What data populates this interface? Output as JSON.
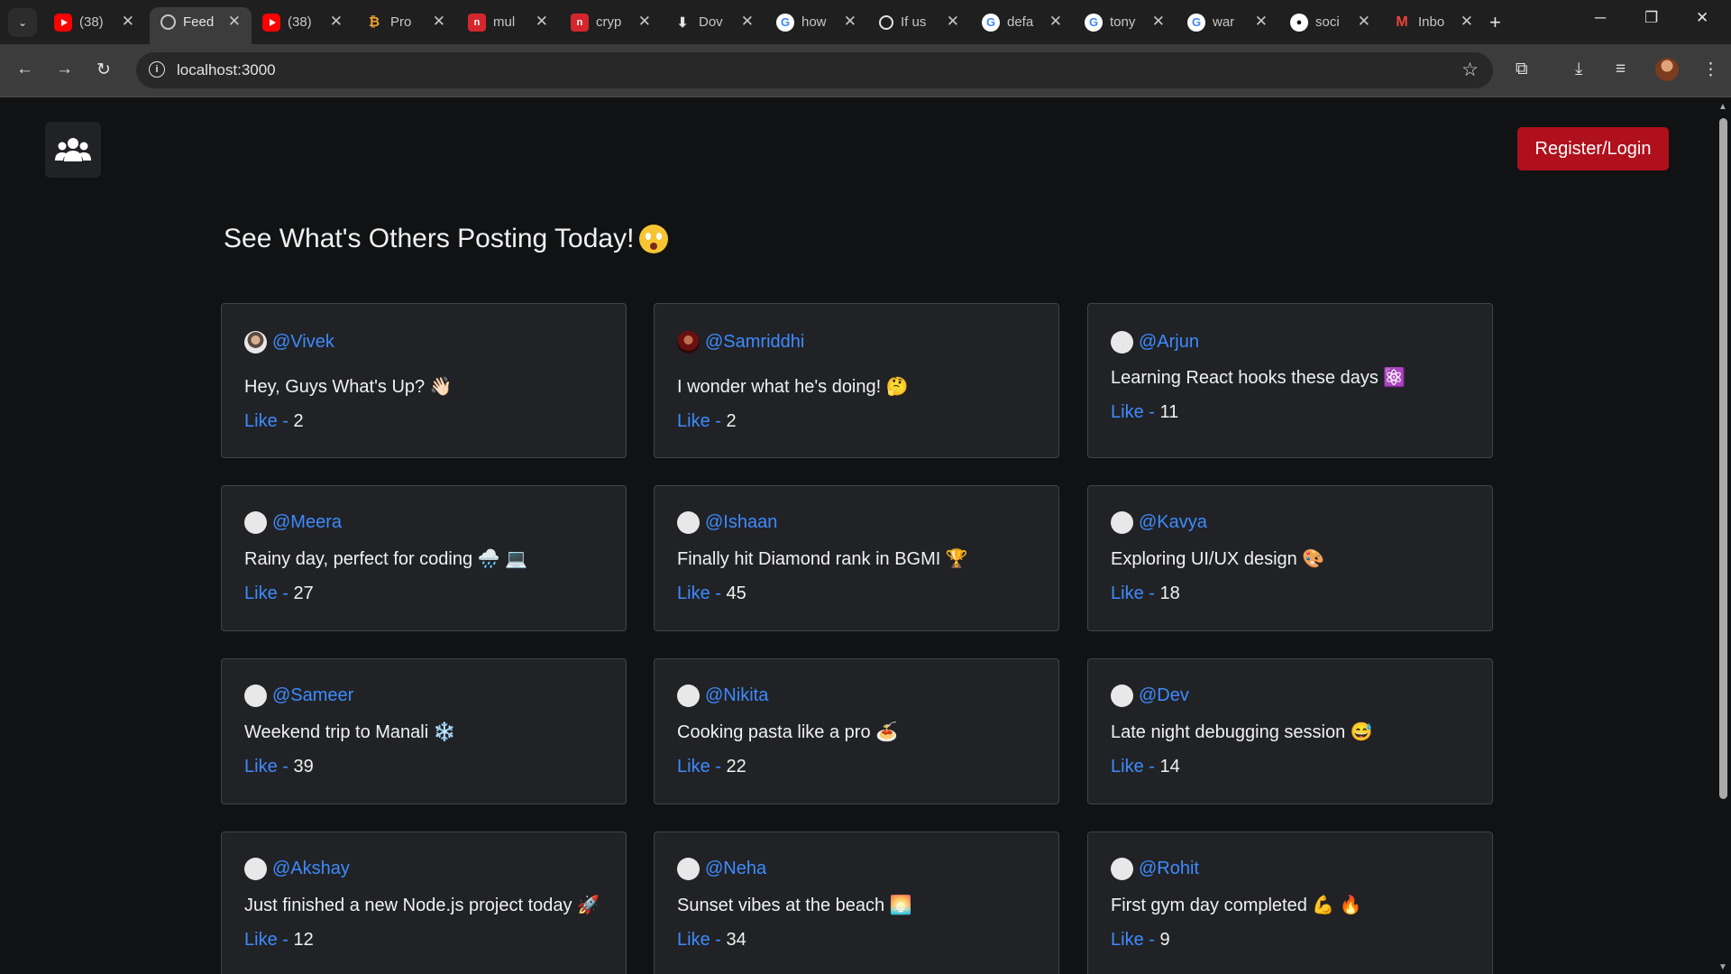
{
  "browser": {
    "tabs": [
      {
        "favicon": "youtube-icon",
        "title": "(38)"
      },
      {
        "favicon": "globe-icon",
        "title": "Feed",
        "active": true
      },
      {
        "favicon": "youtube-icon",
        "title": "(38)"
      },
      {
        "favicon": "bitcoin-icon",
        "title": "Pro"
      },
      {
        "favicon": "n-icon",
        "title": "mul"
      },
      {
        "favicon": "n-icon",
        "title": "cryp"
      },
      {
        "favicon": "download-icon",
        "title": "Dov"
      },
      {
        "favicon": "google-icon",
        "title": "how"
      },
      {
        "favicon": "openai-icon",
        "title": "If us"
      },
      {
        "favicon": "google-icon",
        "title": "defa"
      },
      {
        "favicon": "google-icon",
        "title": "tony"
      },
      {
        "favicon": "google-icon",
        "title": "war"
      },
      {
        "favicon": "github-icon",
        "title": "soci"
      },
      {
        "favicon": "gmail-icon",
        "title": "Inbo"
      }
    ],
    "url": "localhost:3000"
  },
  "header": {
    "login_label": "Register/Login"
  },
  "feed": {
    "headline": "See What's Others Posting Today!",
    "like_label": "Like -",
    "posts": [
      {
        "user": "@Vivek",
        "text": "Hey, Guys What's Up? 👋🏻",
        "likes": "2"
      },
      {
        "user": "@Samriddhi",
        "text": "I wonder what he's doing! 🤔",
        "likes": "2"
      },
      {
        "user": "@Arjun",
        "text": "Learning React hooks these days ⚛️",
        "likes": "11"
      },
      {
        "user": "@Meera",
        "text": "Rainy day, perfect for coding 🌧️ 💻",
        "likes": "27"
      },
      {
        "user": "@Ishaan",
        "text": "Finally hit Diamond rank in BGMI 🏆",
        "likes": "45"
      },
      {
        "user": "@Kavya",
        "text": "Exploring UI/UX design 🎨",
        "likes": "18"
      },
      {
        "user": "@Sameer",
        "text": "Weekend trip to Manali ❄️",
        "likes": "39"
      },
      {
        "user": "@Nikita",
        "text": "Cooking pasta like a pro 🍝",
        "likes": "22"
      },
      {
        "user": "@Dev",
        "text": "Late night debugging session 😅",
        "likes": "14"
      },
      {
        "user": "@Akshay",
        "text": "Just finished a new Node.js project today 🚀",
        "likes": "12"
      },
      {
        "user": "@Neha",
        "text": "Sunset vibes at the beach 🌅",
        "likes": "34"
      },
      {
        "user": "@Rohit",
        "text": "First gym day completed 💪 🔥",
        "likes": "9"
      }
    ]
  }
}
